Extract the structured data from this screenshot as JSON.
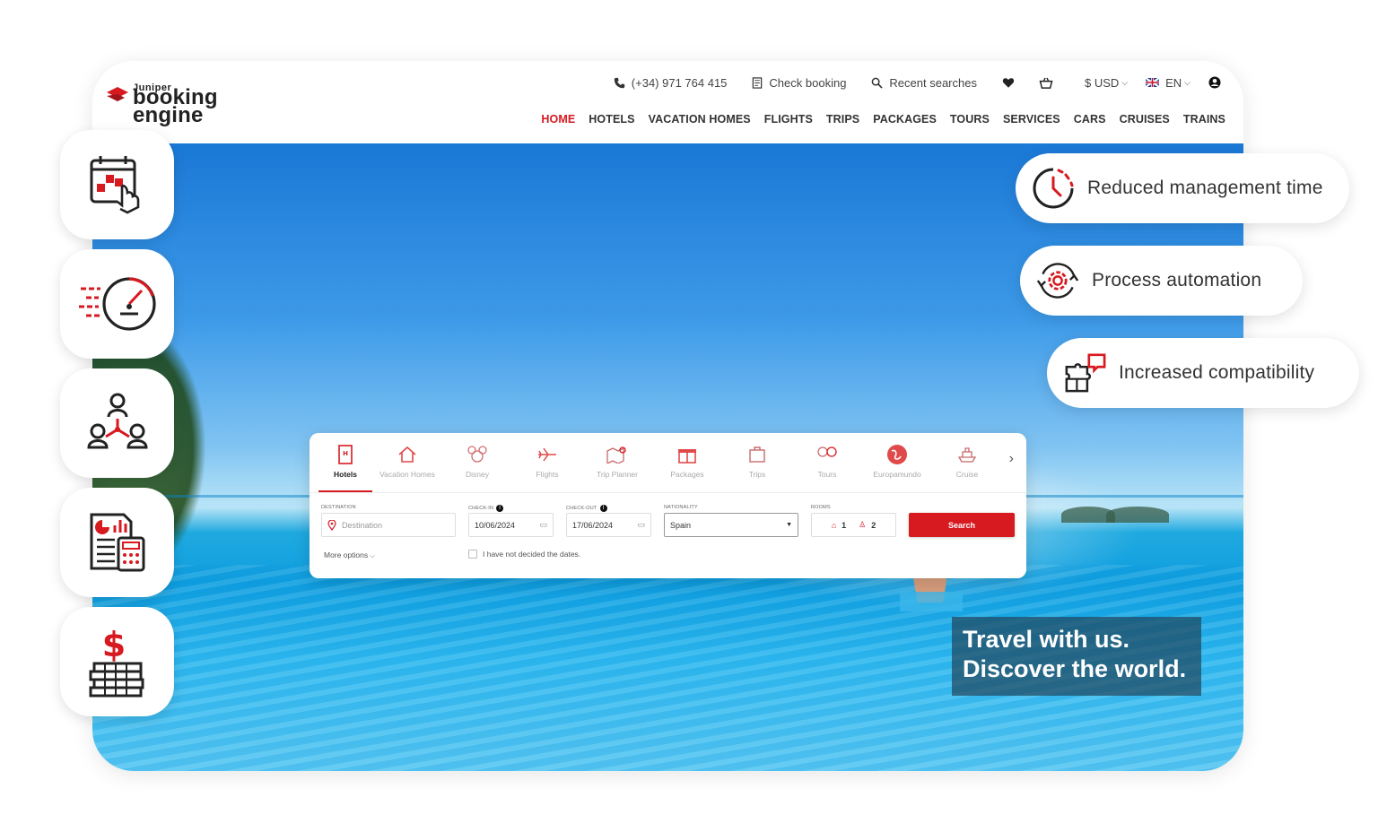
{
  "brand": {
    "small": "Juniper",
    "line1": "booking",
    "line2": "engine"
  },
  "topbar": {
    "phone": "(+34) 971 764 415",
    "check_booking": "Check booking",
    "recent_searches": "Recent searches",
    "currency": "$ USD",
    "language": "EN"
  },
  "nav": {
    "items": [
      "HOME",
      "HOTELS",
      "VACATION HOMES",
      "FLIGHTS",
      "TRIPS",
      "PACKAGES",
      "TOURS",
      "SERVICES",
      "CARS",
      "CRUISES",
      "TRAINS"
    ],
    "active": "HOME"
  },
  "widget": {
    "tabs": [
      "Hotels",
      "Vacation Homes",
      "Disney",
      "Flights",
      "Trip Planner",
      "Packages",
      "Trips",
      "Tours",
      "Europamundo",
      "Cruise"
    ],
    "labels": {
      "destination": "DESTINATION",
      "checkin": "CHECK-IN",
      "checkout": "CHECK-OUT",
      "nationality": "NATIONALITY",
      "rooms": "ROOMS"
    },
    "destination_placeholder": "Destination",
    "checkin_value": "10/06/2024",
    "checkout_value": "17/06/2024",
    "nationality_value": "Spain",
    "rooms_count": "1",
    "guests_count": "2",
    "search_label": "Search",
    "more_options": "More options",
    "no_dates": "I have not decided the dates."
  },
  "hero": {
    "tagline_line1": "Travel with us.",
    "tagline_line2": "Discover the world."
  },
  "features": [
    {
      "label": "Reduced management time",
      "icon": "clock-icon"
    },
    {
      "label": "Process automation",
      "icon": "gear-cycle-icon"
    },
    {
      "label": "Increased compatibility",
      "icon": "puzzle-icon"
    }
  ],
  "side_icons": [
    "calendar-click-icon",
    "speedometer-icon",
    "network-users-icon",
    "report-calculator-icon",
    "money-stack-icon"
  ],
  "colors": {
    "accent": "#d71920",
    "text": "#333333"
  }
}
